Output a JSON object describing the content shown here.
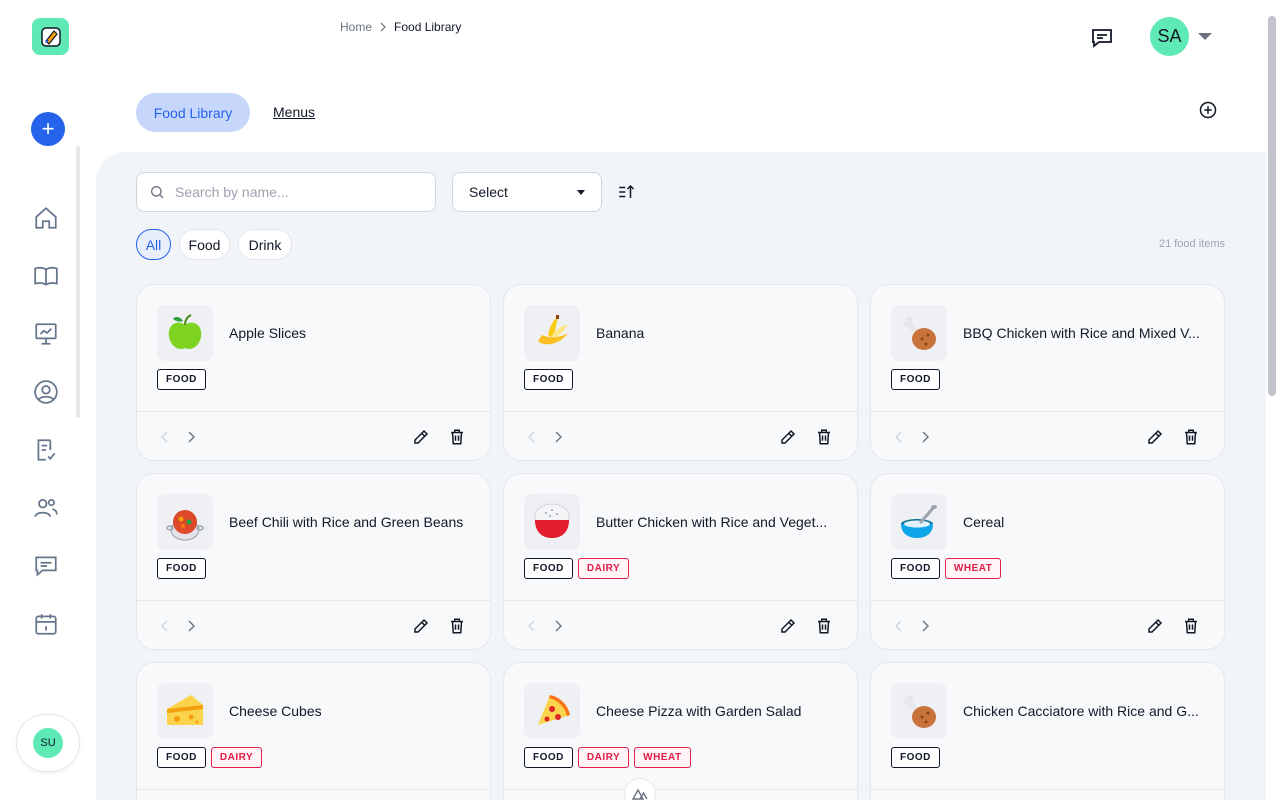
{
  "breadcrumb": {
    "home": "Home",
    "separator": ">",
    "current": "Food Library"
  },
  "header": {
    "user_initials": "SA"
  },
  "sidebar": {
    "user_initials": "SU",
    "add_label": "+"
  },
  "tabs": {
    "active": "Food Library",
    "other": "Menus"
  },
  "filters": {
    "search_placeholder": "Search by name...",
    "select_label": "Select",
    "chips": [
      "All",
      "Food",
      "Drink"
    ],
    "count": "21 food items"
  },
  "cards": [
    {
      "title": "Apple Slices",
      "tags": [
        "FOOD"
      ],
      "icon": "apple-icon"
    },
    {
      "title": "Banana",
      "tags": [
        "FOOD"
      ],
      "icon": "banana-icon"
    },
    {
      "title": "BBQ Chicken with Rice and Mixed V...",
      "tags": [
        "FOOD"
      ],
      "icon": "drumstick-icon"
    },
    {
      "title": "Beef Chili with Rice and Green Beans",
      "tags": [
        "FOOD"
      ],
      "icon": "stew-pot-icon"
    },
    {
      "title": "Butter Chicken with Rice and Veget...",
      "tags": [
        "FOOD",
        "DAIRY"
      ],
      "icon": "rice-bowl-icon"
    },
    {
      "title": "Cereal",
      "tags": [
        "FOOD",
        "WHEAT"
      ],
      "icon": "cereal-bowl-icon"
    },
    {
      "title": "Cheese Cubes",
      "tags": [
        "FOOD",
        "DAIRY"
      ],
      "icon": "cheese-icon"
    },
    {
      "title": "Cheese Pizza with Garden Salad",
      "tags": [
        "FOOD",
        "DAIRY",
        "WHEAT"
      ],
      "icon": "pizza-icon"
    },
    {
      "title": "Chicken Cacciatore with Rice and G...",
      "tags": [
        "FOOD"
      ],
      "icon": "drumstick-icon"
    }
  ],
  "colors": {
    "accent": "#2563eb",
    "avatar": "#5ee9b5",
    "allergen": "#e11d48"
  }
}
